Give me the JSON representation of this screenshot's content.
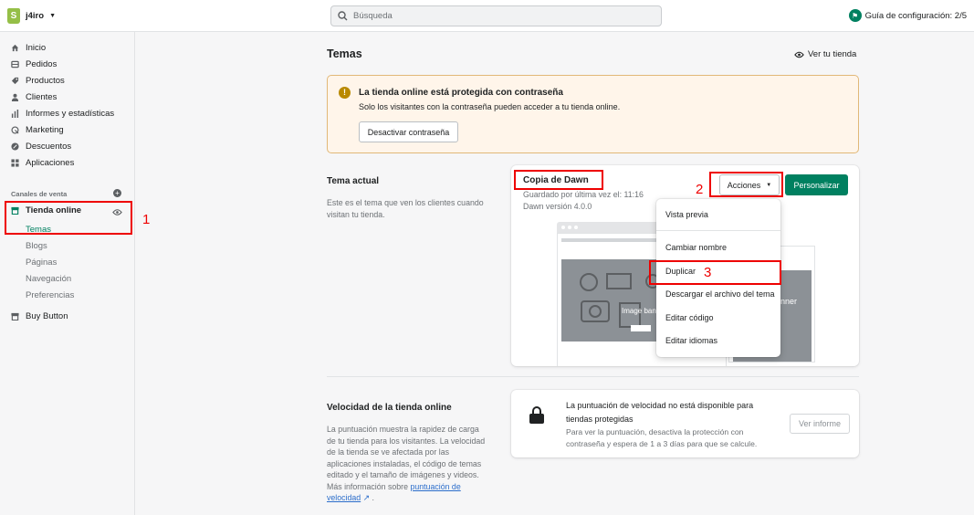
{
  "topbar": {
    "store_name": "j4iro",
    "search_placeholder": "Búsqueda",
    "setup_guide": "Guía de configuración: 2/5"
  },
  "sidebar": {
    "items": [
      {
        "label": "Inicio",
        "icon": "home-icon"
      },
      {
        "label": "Pedidos",
        "icon": "orders-icon"
      },
      {
        "label": "Productos",
        "icon": "tag-icon"
      },
      {
        "label": "Clientes",
        "icon": "person-icon"
      },
      {
        "label": "Informes y estadísticas",
        "icon": "bar-chart-icon"
      },
      {
        "label": "Marketing",
        "icon": "marketing-icon"
      },
      {
        "label": "Descuentos",
        "icon": "discount-icon"
      },
      {
        "label": "Aplicaciones",
        "icon": "apps-icon"
      }
    ],
    "sales_channels_label": "Canales de venta",
    "online_store": "Tienda online",
    "online_store_subitems": [
      "Temas",
      "Blogs",
      "Páginas",
      "Navegación",
      "Preferencias"
    ],
    "buy_button": "Buy Button"
  },
  "page": {
    "title": "Temas",
    "view_store": "Ver tu tienda"
  },
  "banner": {
    "title": "La tienda online está protegida con contraseña",
    "text": "Solo los visitantes con la contraseña pueden acceder a tu tienda online.",
    "button": "Desactivar contraseña"
  },
  "current_theme": {
    "section_title": "Tema actual",
    "section_desc": "Este es el tema que ven los clientes cuando visitan tu tienda.",
    "name": "Copia de Dawn",
    "saved": "Guardado por última vez el: 11:16",
    "version": "Dawn versión 4.0.0",
    "actions_button": "Acciones",
    "customize_button": "Personalizar",
    "preview_caption": "Image banner",
    "mobile_caption": "nner"
  },
  "actions_menu": {
    "items": [
      "Vista previa",
      "Cambiar nombre",
      "Duplicar",
      "Descargar el archivo del tema",
      "Editar código",
      "Editar idiomas"
    ]
  },
  "speed": {
    "section_title": "Velocidad de la tienda online",
    "section_desc": "La puntuación muestra la rapidez de carga de tu tienda para los visitantes. La velocidad de la tienda se ve afectada por las aplicaciones instaladas, el código de temas editado y el tamaño de imágenes y videos. Más información sobre",
    "link_text": "puntuación de velocidad",
    "card_title": "La puntuación de velocidad no está disponible para tiendas protegidas",
    "card_text": "Para ver la puntuación, desactiva la protección con contraseña y espera de 1 a 3 días para que se calcule.",
    "report_button": "Ver informe"
  },
  "annotations": {
    "step1": "1",
    "step2": "2",
    "step3": "3",
    "color": "#e00000"
  },
  "colors": {
    "primary": "#008060",
    "warning_bg": "#fff5ea",
    "link": "#2c6ecb"
  }
}
